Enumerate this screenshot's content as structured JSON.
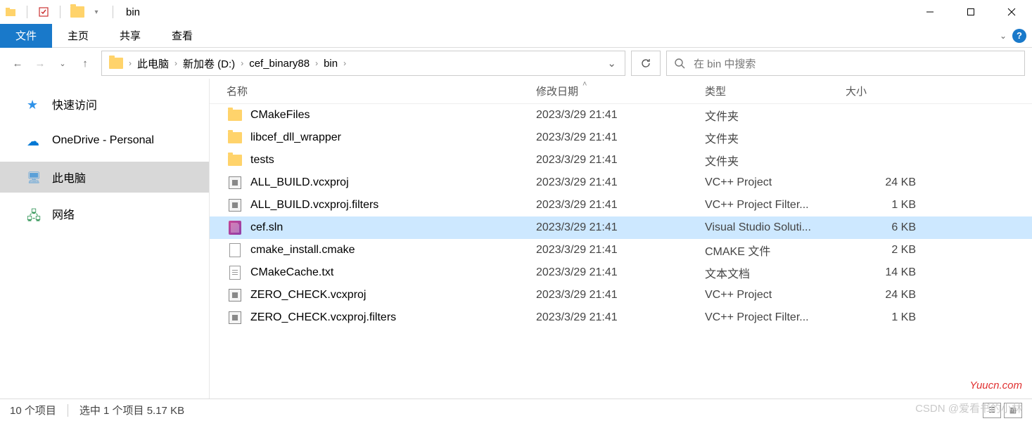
{
  "titlebar": {
    "title": "bin"
  },
  "ribbon": {
    "file": "文件",
    "tabs": [
      "主页",
      "共享",
      "查看"
    ]
  },
  "breadcrumb": [
    "此电脑",
    "新加卷 (D:)",
    "cef_binary88",
    "bin"
  ],
  "search": {
    "placeholder": "在 bin 中搜索"
  },
  "sidebar": {
    "items": [
      {
        "label": "快速访问",
        "icon": "star"
      },
      {
        "label": "OneDrive - Personal",
        "icon": "cloud"
      },
      {
        "label": "此电脑",
        "icon": "pc",
        "active": true
      },
      {
        "label": "网络",
        "icon": "net"
      }
    ]
  },
  "columns": {
    "name": "名称",
    "date": "修改日期",
    "type": "类型",
    "size": "大小"
  },
  "files": [
    {
      "name": "CMakeFiles",
      "date": "2023/3/29 21:41",
      "type": "文件夹",
      "size": "",
      "icon": "folder"
    },
    {
      "name": "libcef_dll_wrapper",
      "date": "2023/3/29 21:41",
      "type": "文件夹",
      "size": "",
      "icon": "folder"
    },
    {
      "name": "tests",
      "date": "2023/3/29 21:41",
      "type": "文件夹",
      "size": "",
      "icon": "folder"
    },
    {
      "name": "ALL_BUILD.vcxproj",
      "date": "2023/3/29 21:41",
      "type": "VC++ Project",
      "size": "24 KB",
      "icon": "vcx"
    },
    {
      "name": "ALL_BUILD.vcxproj.filters",
      "date": "2023/3/29 21:41",
      "type": "VC++ Project Filter...",
      "size": "1 KB",
      "icon": "vcx"
    },
    {
      "name": "cef.sln",
      "date": "2023/3/29 21:41",
      "type": "Visual Studio Soluti...",
      "size": "6 KB",
      "icon": "sln",
      "selected": true
    },
    {
      "name": "cmake_install.cmake",
      "date": "2023/3/29 21:41",
      "type": "CMAKE 文件",
      "size": "2 KB",
      "icon": "file"
    },
    {
      "name": "CMakeCache.txt",
      "date": "2023/3/29 21:41",
      "type": "文本文档",
      "size": "14 KB",
      "icon": "txt"
    },
    {
      "name": "ZERO_CHECK.vcxproj",
      "date": "2023/3/29 21:41",
      "type": "VC++ Project",
      "size": "24 KB",
      "icon": "vcx"
    },
    {
      "name": "ZERO_CHECK.vcxproj.filters",
      "date": "2023/3/29 21:41",
      "type": "VC++ Project Filter...",
      "size": "1 KB",
      "icon": "vcx"
    }
  ],
  "status": {
    "count": "10 个项目",
    "selection": "选中 1 个项目  5.17 KB"
  },
  "watermark1": "Yuucn.com",
  "watermark2": "CSDN @爱看书的小林"
}
